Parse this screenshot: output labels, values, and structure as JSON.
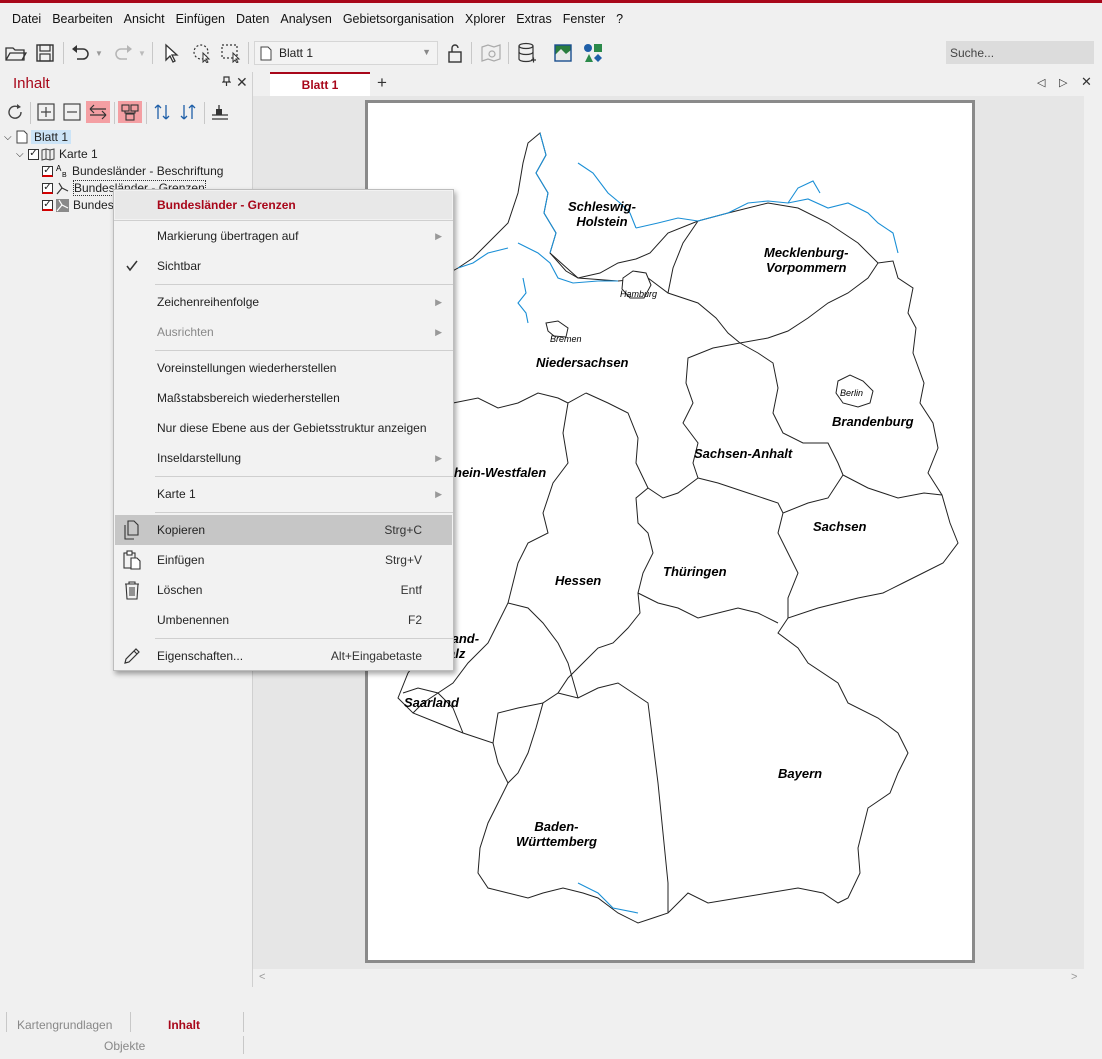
{
  "menu": [
    "Datei",
    "Bearbeiten",
    "Ansicht",
    "Einfügen",
    "Daten",
    "Analysen",
    "Gebietsorganisation",
    "Xplorer",
    "Extras",
    "Fenster",
    "?"
  ],
  "toolbar": {
    "sheet_combo": "Blatt 1",
    "search_placeholder": "Suche..."
  },
  "panel": {
    "title": "Inhalt",
    "pin": "📌",
    "close": "✕"
  },
  "tree": {
    "root": "Blatt 1",
    "map": "Karte 1",
    "layers": [
      "Bundesländer - Beschriftung",
      "Bundesländer - Grenzen",
      "Bundes"
    ]
  },
  "bottom_tabs": {
    "left": "Kartengrundlagen",
    "active": "Inhalt",
    "lower": "Objekte"
  },
  "tabs": {
    "active": "Blatt 1",
    "add": "+"
  },
  "context_menu": {
    "header": "Bundesländer - Grenzen",
    "items": [
      {
        "label": "Markierung übertragen auf",
        "submenu": true
      },
      {
        "label": "Sichtbar",
        "checked": true
      },
      {
        "label": "Zeichenreihenfolge",
        "submenu": true
      },
      {
        "label": "Ausrichten",
        "submenu": true,
        "disabled": true
      },
      {
        "label": "Voreinstellungen wiederherstellen"
      },
      {
        "label": "Maßstabsbereich wiederherstellen"
      },
      {
        "label": "Nur diese Ebene aus der Gebietsstruktur anzeigen"
      },
      {
        "label": "Inseldarstellung",
        "submenu": true
      },
      {
        "label": "Karte 1",
        "submenu": true
      },
      {
        "label": "Kopieren",
        "shortcut": "Strg+C",
        "icon": "copy-icon",
        "highlighted": true
      },
      {
        "label": "Einfügen",
        "shortcut": "Strg+V",
        "icon": "paste-icon"
      },
      {
        "label": "Löschen",
        "shortcut": "Entf",
        "icon": "trash-icon"
      },
      {
        "label": "Umbenennen",
        "shortcut": "F2"
      },
      {
        "label": "Eigenschaften...",
        "shortcut": "Alt+Eingabetaste",
        "icon": "pencil-icon"
      }
    ]
  },
  "map_labels": {
    "schleswig": "Schleswig-\nHolstein",
    "mecklenburg": "Mecklenburg-\nVorpommern",
    "hamburg": "Hamburg",
    "bremen": "Bremen",
    "niedersachsen": "Niedersachsen",
    "berlin": "Berlin",
    "brandenburg": "Brandenburg",
    "sachsen_anhalt": "Sachsen-Anhalt",
    "nrw": "hein-Westfalen",
    "sachsen": "Sachsen",
    "hessen": "Hessen",
    "thueringen": "Thüringen",
    "rlp": "land-\nalz",
    "saarland": "Saarland",
    "bayern": "Bayern",
    "bw": "Baden-\nWürttemberg"
  },
  "colors": {
    "accent": "#a8071a",
    "water": "#1a8fd6",
    "highlight": "#c6c6c6"
  }
}
